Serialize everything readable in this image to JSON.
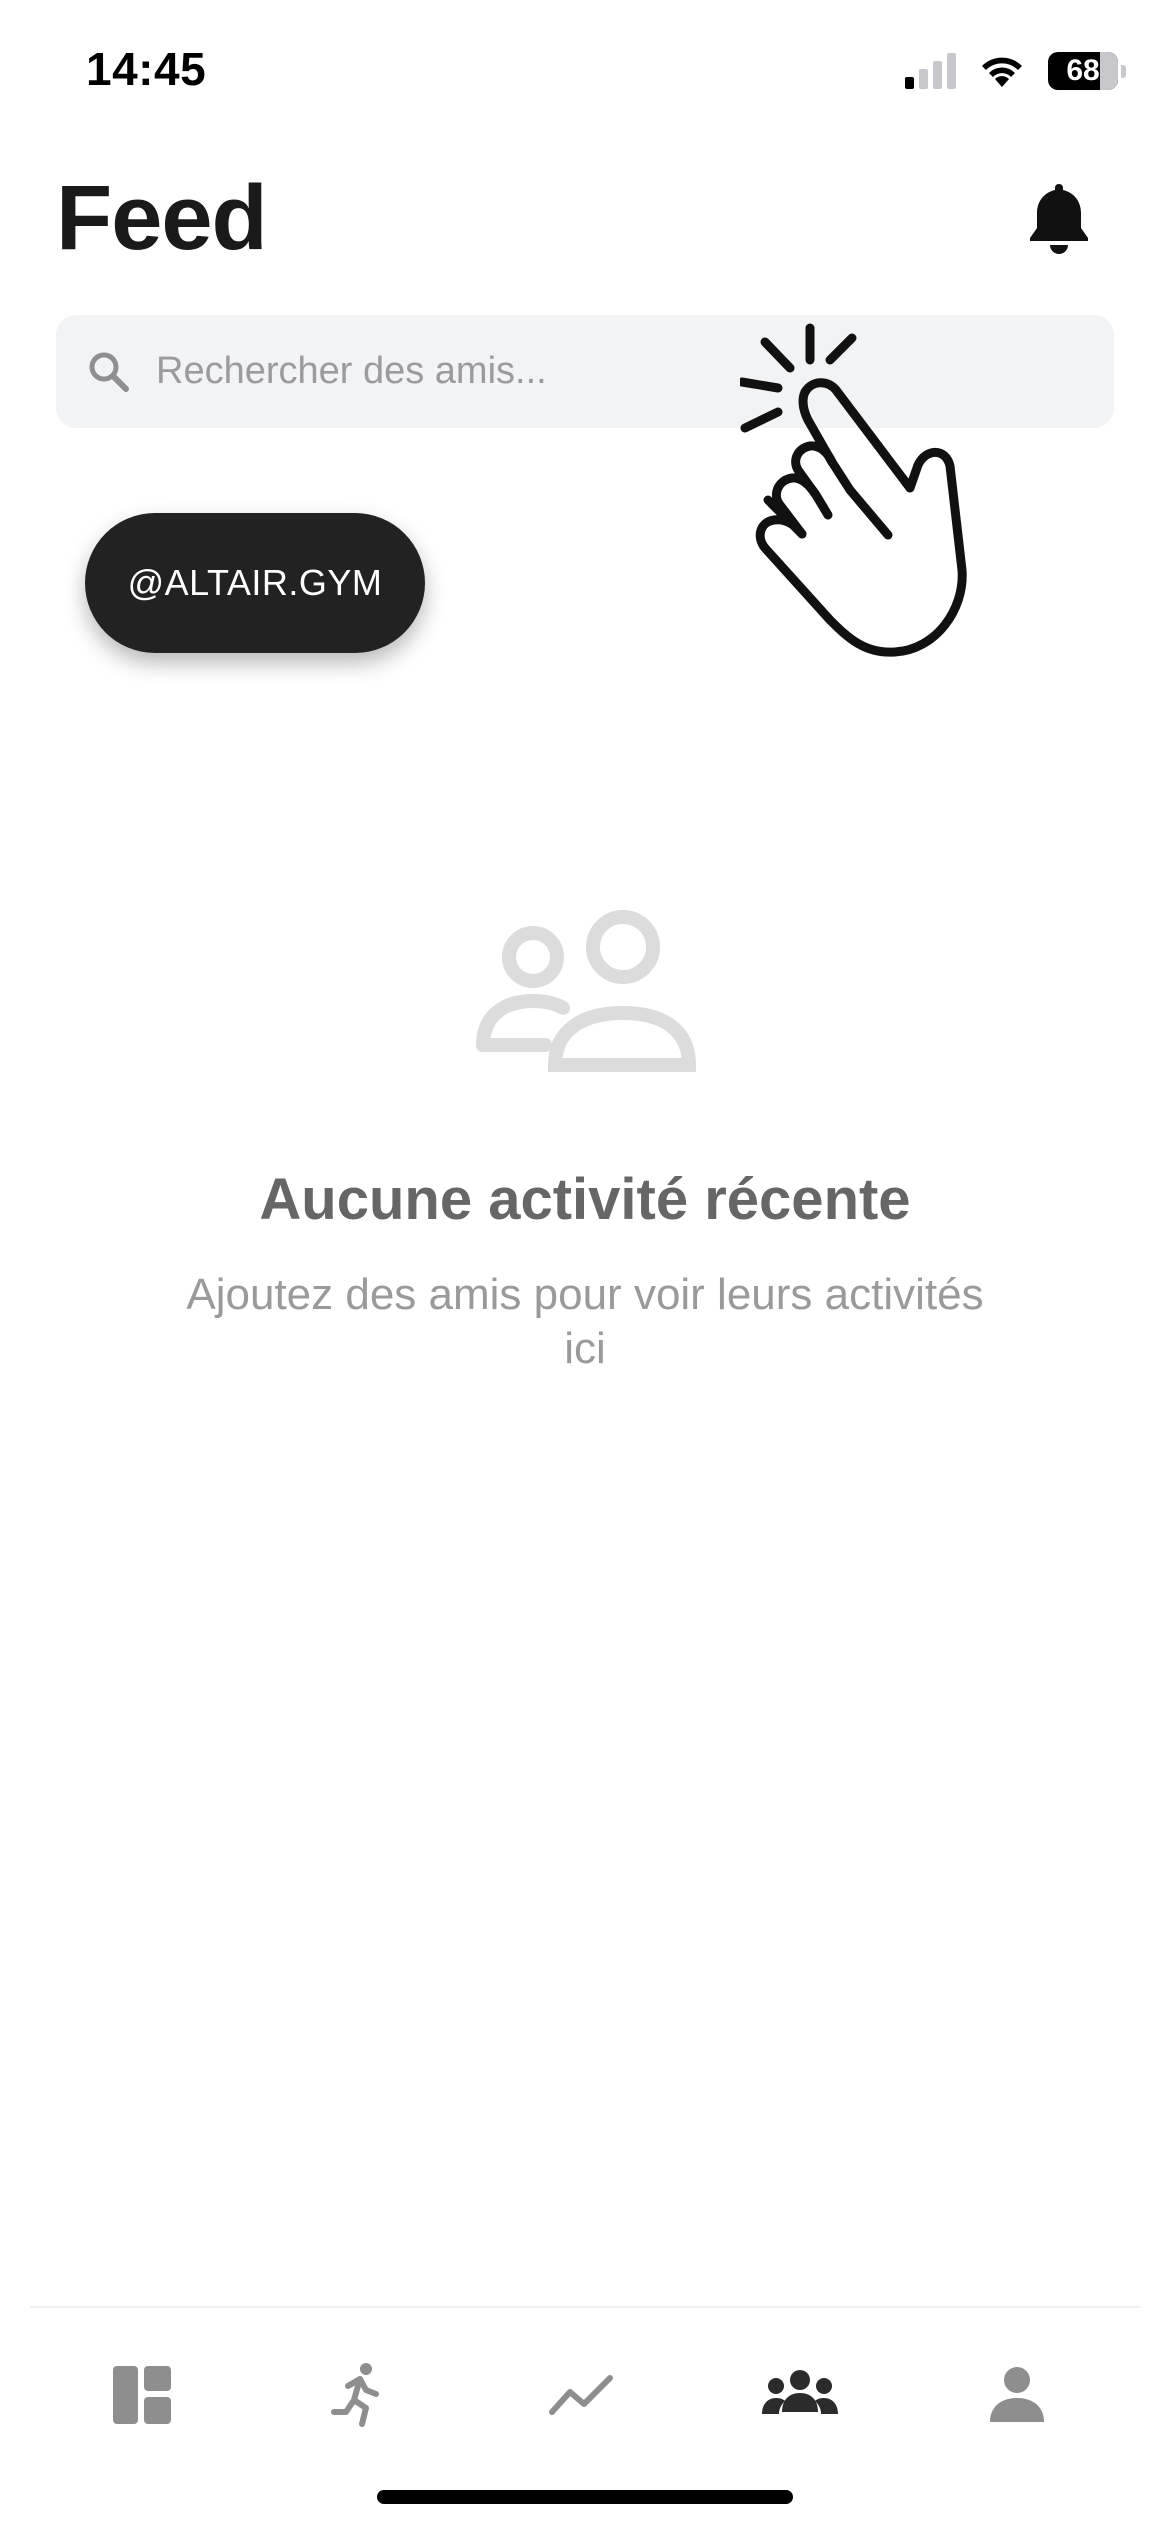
{
  "status_bar": {
    "time": "14:45",
    "battery": "68",
    "icons": [
      "signal-icon",
      "wifi-icon",
      "battery-icon"
    ]
  },
  "header": {
    "title": "Feed",
    "notification_icon": "bell-icon"
  },
  "search": {
    "placeholder": "Rechercher des amis...",
    "icon": "search-icon"
  },
  "chip": {
    "label": "@ALTAIR.GYM"
  },
  "overlay": {
    "icon": "tap-hand-icon"
  },
  "empty_state": {
    "icon": "friends-icon",
    "title": "Aucune activité récente",
    "subtitle": "Ajoutez des amis pour voir leurs activités ici"
  },
  "tab_bar": {
    "items": [
      {
        "icon": "dashboard-icon",
        "active": false
      },
      {
        "icon": "running-icon",
        "active": false
      },
      {
        "icon": "trend-icon",
        "active": false
      },
      {
        "icon": "group-icon",
        "active": true
      },
      {
        "icon": "profile-icon",
        "active": false
      }
    ]
  },
  "colors": {
    "active_tab": "#2b2b2b",
    "inactive_tab": "#8e8e8e",
    "chip_background": "#222222",
    "search_background": "#f2f3f5"
  }
}
